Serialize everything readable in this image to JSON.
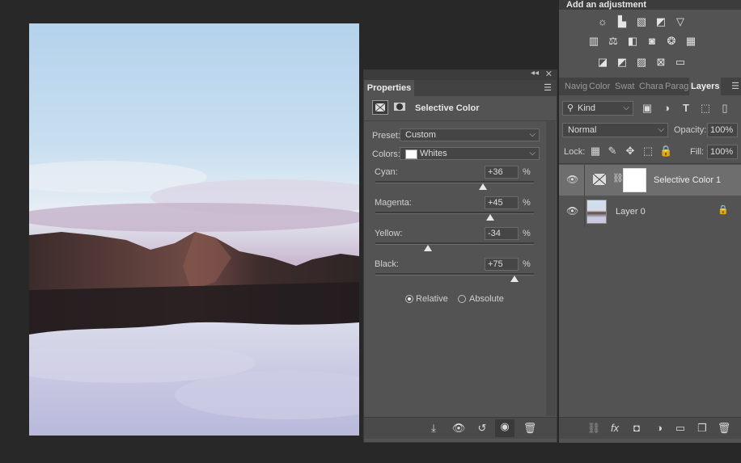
{
  "adjustments": {
    "title": "Add an adjustment",
    "row1": [
      "brightness-icon",
      "levels-icon",
      "curves-icon",
      "exposure-icon",
      "vibrance-icon"
    ],
    "row2": [
      "hue-saturation-icon",
      "color-balance-icon",
      "black-white-icon",
      "photo-filter-icon",
      "channel-mixer-icon",
      "color-lookup-icon"
    ],
    "row3": [
      "invert-icon",
      "posterize-icon",
      "threshold-icon",
      "selective-color-icon",
      "gradient-map-icon"
    ]
  },
  "properties": {
    "tab": "Properties",
    "title": "Selective Color",
    "preset_label": "Preset:",
    "preset_value": "Custom",
    "colors_label": "Colors:",
    "colors_value": "Whites",
    "sliders": [
      {
        "label": "Cyan:",
        "value": "+36",
        "unit": "%",
        "percent": 36
      },
      {
        "label": "Magenta:",
        "value": "+45",
        "unit": "%",
        "percent": 45
      },
      {
        "label": "Yellow:",
        "value": "-34",
        "unit": "%",
        "percent": -34
      },
      {
        "label": "Black:",
        "value": "+75",
        "unit": "%",
        "percent": 75
      }
    ],
    "method_relative": "Relative",
    "method_absolute": "Absolute",
    "method_selected": "Relative"
  },
  "layers": {
    "tabs": [
      "Navig",
      "Color",
      "Swat",
      "Chara",
      "Parag",
      "Layers"
    ],
    "active_tab": "Layers",
    "filter_kind": "Kind",
    "blend_mode": "Normal",
    "opacity_label": "Opacity:",
    "opacity_value": "100%",
    "lock_label": "Lock:",
    "fill_label": "Fill:",
    "fill_value": "100%",
    "items": [
      {
        "name": "Selective Color 1",
        "selected": true
      },
      {
        "name": "Layer 0",
        "selected": false
      }
    ]
  }
}
